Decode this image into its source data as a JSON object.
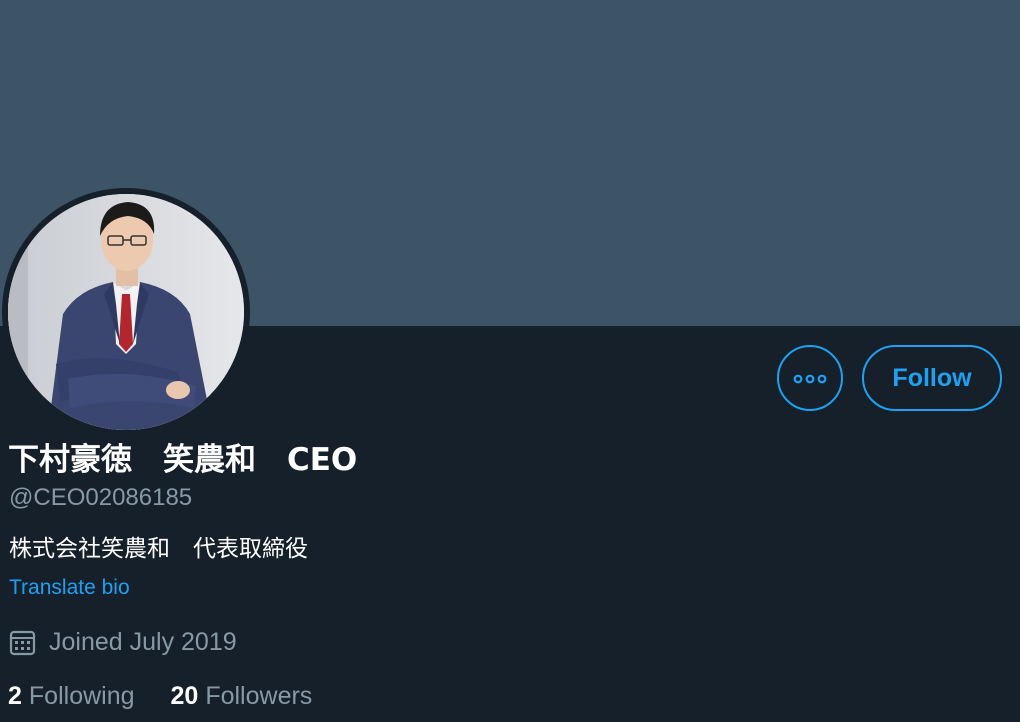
{
  "profile": {
    "name": "下村豪徳　笑農和　CEO",
    "handle": "@CEO02086185",
    "bio": "株式会社笑農和　代表取締役",
    "translate_label": "Translate bio",
    "joined": "Joined July 2019",
    "following_count": "2",
    "following_label": "Following",
    "followers_count": "20",
    "followers_label": "Followers"
  },
  "actions": {
    "more_icon": "more-dots-icon",
    "follow_label": "Follow"
  },
  "icons": {
    "joined": "calendar-icon"
  },
  "colors": {
    "background": "#15202b",
    "banner": "#3d5466",
    "accent": "#1da1f2",
    "secondary_text": "#8899a6",
    "primary_text": "#ffffff"
  }
}
